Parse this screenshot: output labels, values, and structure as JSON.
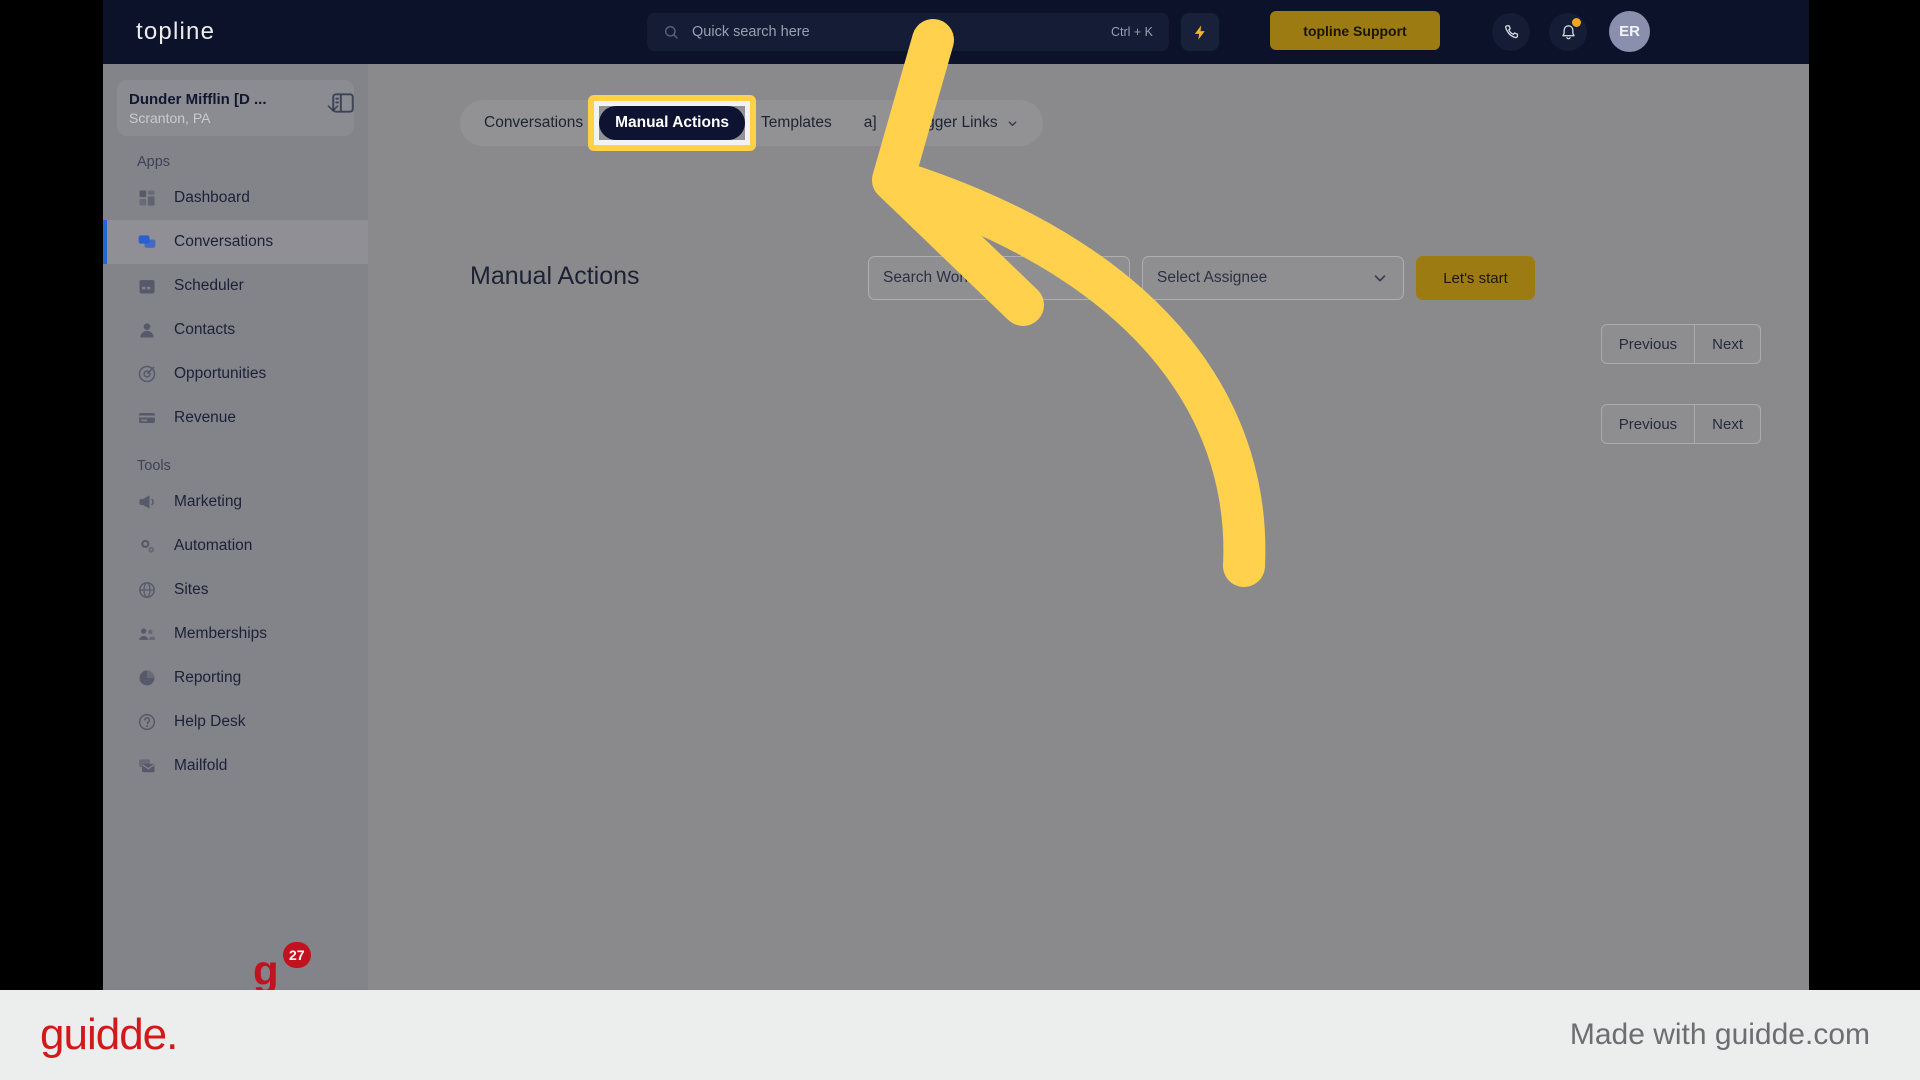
{
  "header": {
    "logo": "topline",
    "search": {
      "placeholder": "Quick search here",
      "shortcut": "Ctrl + K",
      "icon": "search-icon"
    },
    "bolt_icon": "lightning-bolt-icon",
    "support_button": "topline Support",
    "phone_icon": "phone-icon",
    "bell_icon": "bell-icon",
    "avatar_initials": "ER"
  },
  "sidebar": {
    "org_name": "Dunder Mifflin [D ...",
    "org_location": "Scranton, PA",
    "panel_toggle_icon": "sidebar-panel-toggle-icon",
    "sections": [
      {
        "label": "Apps",
        "items": [
          {
            "label": "Dashboard",
            "icon": "dashboard-icon",
            "active": false
          },
          {
            "label": "Conversations",
            "icon": "conversations-icon",
            "active": true
          },
          {
            "label": "Scheduler",
            "icon": "calendar-icon",
            "active": false
          },
          {
            "label": "Contacts",
            "icon": "person-icon",
            "active": false
          },
          {
            "label": "Opportunities",
            "icon": "target-icon",
            "active": false
          },
          {
            "label": "Revenue",
            "icon": "card-icon",
            "active": false
          }
        ]
      },
      {
        "label": "Tools",
        "items": [
          {
            "label": "Marketing",
            "icon": "megaphone-icon",
            "active": false
          },
          {
            "label": "Automation",
            "icon": "gears-icon",
            "active": false
          },
          {
            "label": "Sites",
            "icon": "globe-icon",
            "active": false
          },
          {
            "label": "Memberships",
            "icon": "members-icon",
            "active": false
          },
          {
            "label": "Reporting",
            "icon": "pie-chart-icon",
            "active": false
          },
          {
            "label": "Help Desk",
            "icon": "question-icon",
            "active": false
          },
          {
            "label": "Mailfold",
            "icon": "mail-stack-icon",
            "active": false
          }
        ]
      }
    ],
    "badge_mark": "g",
    "badge_count": "27"
  },
  "main": {
    "tabs": [
      {
        "label": "Conversations",
        "active": false,
        "chevron": false
      },
      {
        "label": "Manual Actions",
        "active": true,
        "chevron": false
      },
      {
        "label": "Templates",
        "active": false,
        "chevron": false
      },
      {
        "label": "a]",
        "active": false,
        "chevron": false
      },
      {
        "label": "Trigger Links",
        "active": false,
        "chevron": true
      }
    ],
    "page_title": "Manual Actions",
    "workflow_select": "Search Workflows",
    "assignee_select": "Select Assignee",
    "start_button": "Let's start",
    "pagination": {
      "previous": "Previous",
      "next": "Next"
    }
  },
  "footer": {
    "logo": "guidde.",
    "made_with": "Made with guidde.com"
  },
  "colors": {
    "header_bg": "#0b1229",
    "accent_gold": "#9c7b12",
    "highlight_yellow": "#ffd147",
    "arrow_yellow": "#ffd14d",
    "active_blue": "#2563d8",
    "badge_red": "#c1121f",
    "guidde_red": "#d21919"
  }
}
